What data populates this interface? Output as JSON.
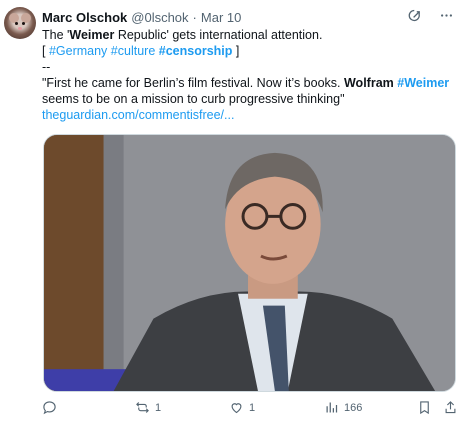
{
  "post": {
    "author_name": "Marc Olschok",
    "author_handle": "@0lschok",
    "separator": "·",
    "date": "Mar 10",
    "body": {
      "line1_a": "The '",
      "line1_b": "Weimer",
      "line1_c": " Republic' gets international attention.",
      "line2_open": "[ ",
      "line2_tag1": "#Germany",
      "line2_tag2": "#culture",
      "line2_tag3": "#censorship",
      "line2_close": " ]",
      "line3": "--",
      "line4": "\"First he came for Berlin’s film festival. Now it’s books. ",
      "line4_bold": "Wolfram",
      "line4_tag": "#Weimer",
      "line5": "seems to be on a mission to curb progressive thinking\"",
      "link": "theguardian.com/commentisfree/..."
    }
  },
  "actions": {
    "reply_count": "",
    "repost_count": "1",
    "like_count": "1",
    "views_count": "166"
  },
  "icons": {
    "grok": "grok-icon",
    "more": "more-icon",
    "reply": "reply-icon",
    "repost": "repost-icon",
    "like": "heart-icon",
    "views": "views-icon",
    "bookmark": "bookmark-icon",
    "share": "share-icon"
  },
  "colors": {
    "link": "#1d9bf0",
    "muted": "#536471",
    "text": "#0f1419"
  }
}
